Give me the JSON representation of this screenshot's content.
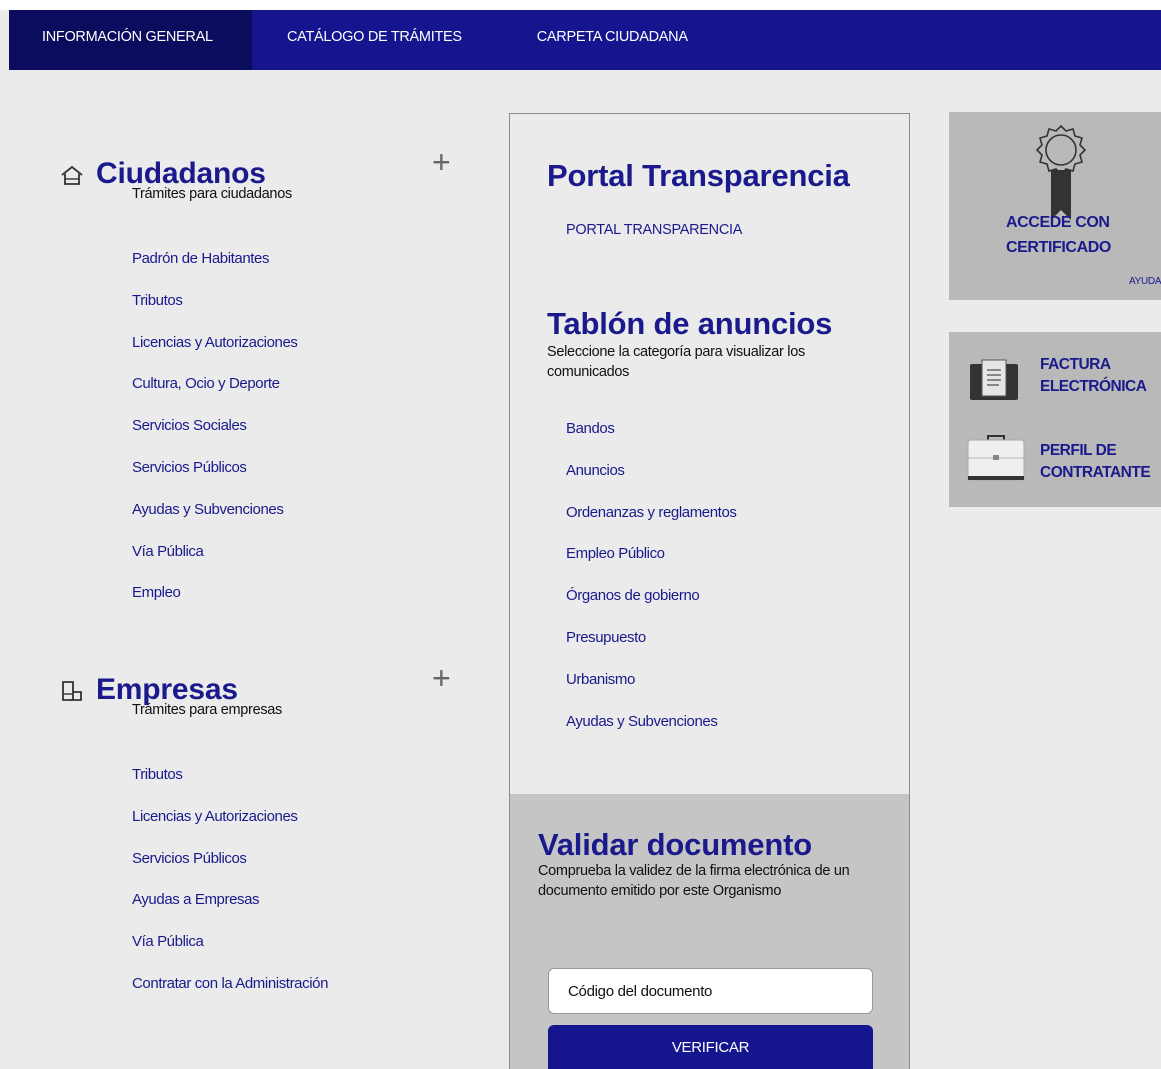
{
  "nav": {
    "items": [
      "INFORMACIÓN GENERAL",
      "CATÁLOGO DE TRÁMITES",
      "CARPETA CIUDADANA"
    ]
  },
  "ciudadanos": {
    "title": "Ciudadanos",
    "subtitle": "Trámites para ciudadanos",
    "expand": "+",
    "links": [
      "Padrón de Habitantes",
      "Tributos",
      "Licencias y Autorizaciones",
      "Cultura, Ocio y Deporte",
      "Servicios Sociales",
      "Servicios Públicos",
      "Ayudas y Subvenciones",
      "Vía Pública",
      "Empleo"
    ]
  },
  "empresas": {
    "title": "Empresas",
    "subtitle": "Trámites para empresas",
    "expand": "+",
    "links": [
      "Tributos",
      "Licencias y Autorizaciones",
      "Servicios Públicos",
      "Ayudas a Empresas",
      "Vía Pública",
      "Contratar con la Administración"
    ]
  },
  "transparencia": {
    "title": "Portal Transparencia",
    "link": "PORTAL TRANSPARENCIA"
  },
  "tablon": {
    "title": "Tablón de anuncios",
    "subtitle": "Seleccione la categoría para visualizar los comunicados",
    "links": [
      "Bandos",
      "Anuncios",
      "Ordenanzas y reglamentos",
      "Empleo Público",
      "Órganos de gobierno",
      "Presupuesto",
      "Urbanismo",
      "Ayudas y Subvenciones"
    ]
  },
  "validar": {
    "title": "Validar documento",
    "subtitle": "Comprueba la validez de la firma electrónica de un documento emitido por este Organismo",
    "placeholder": "Código del documento",
    "button": "VERIFICAR"
  },
  "certificado": {
    "label_line1": "ACCEDE CON",
    "label_line2": "CERTIFICADO",
    "help": "AYUDA"
  },
  "side_links": {
    "factura_line1": "FACTURA",
    "factura_line2": "ELECTRÓNICA",
    "perfil_line1": "PERFIL DE",
    "perfil_line2": "CONTRATANTE"
  },
  "colors": {
    "primary": "#15158f",
    "nav_active": "#0c0c5e",
    "link": "#1a1a8c",
    "background": "#ebebeb",
    "panel_gray": "#b9b9b9"
  },
  "icons": [
    "home-icon",
    "building-icon",
    "certificate-badge-icon",
    "invoice-icon",
    "briefcase-icon"
  ]
}
